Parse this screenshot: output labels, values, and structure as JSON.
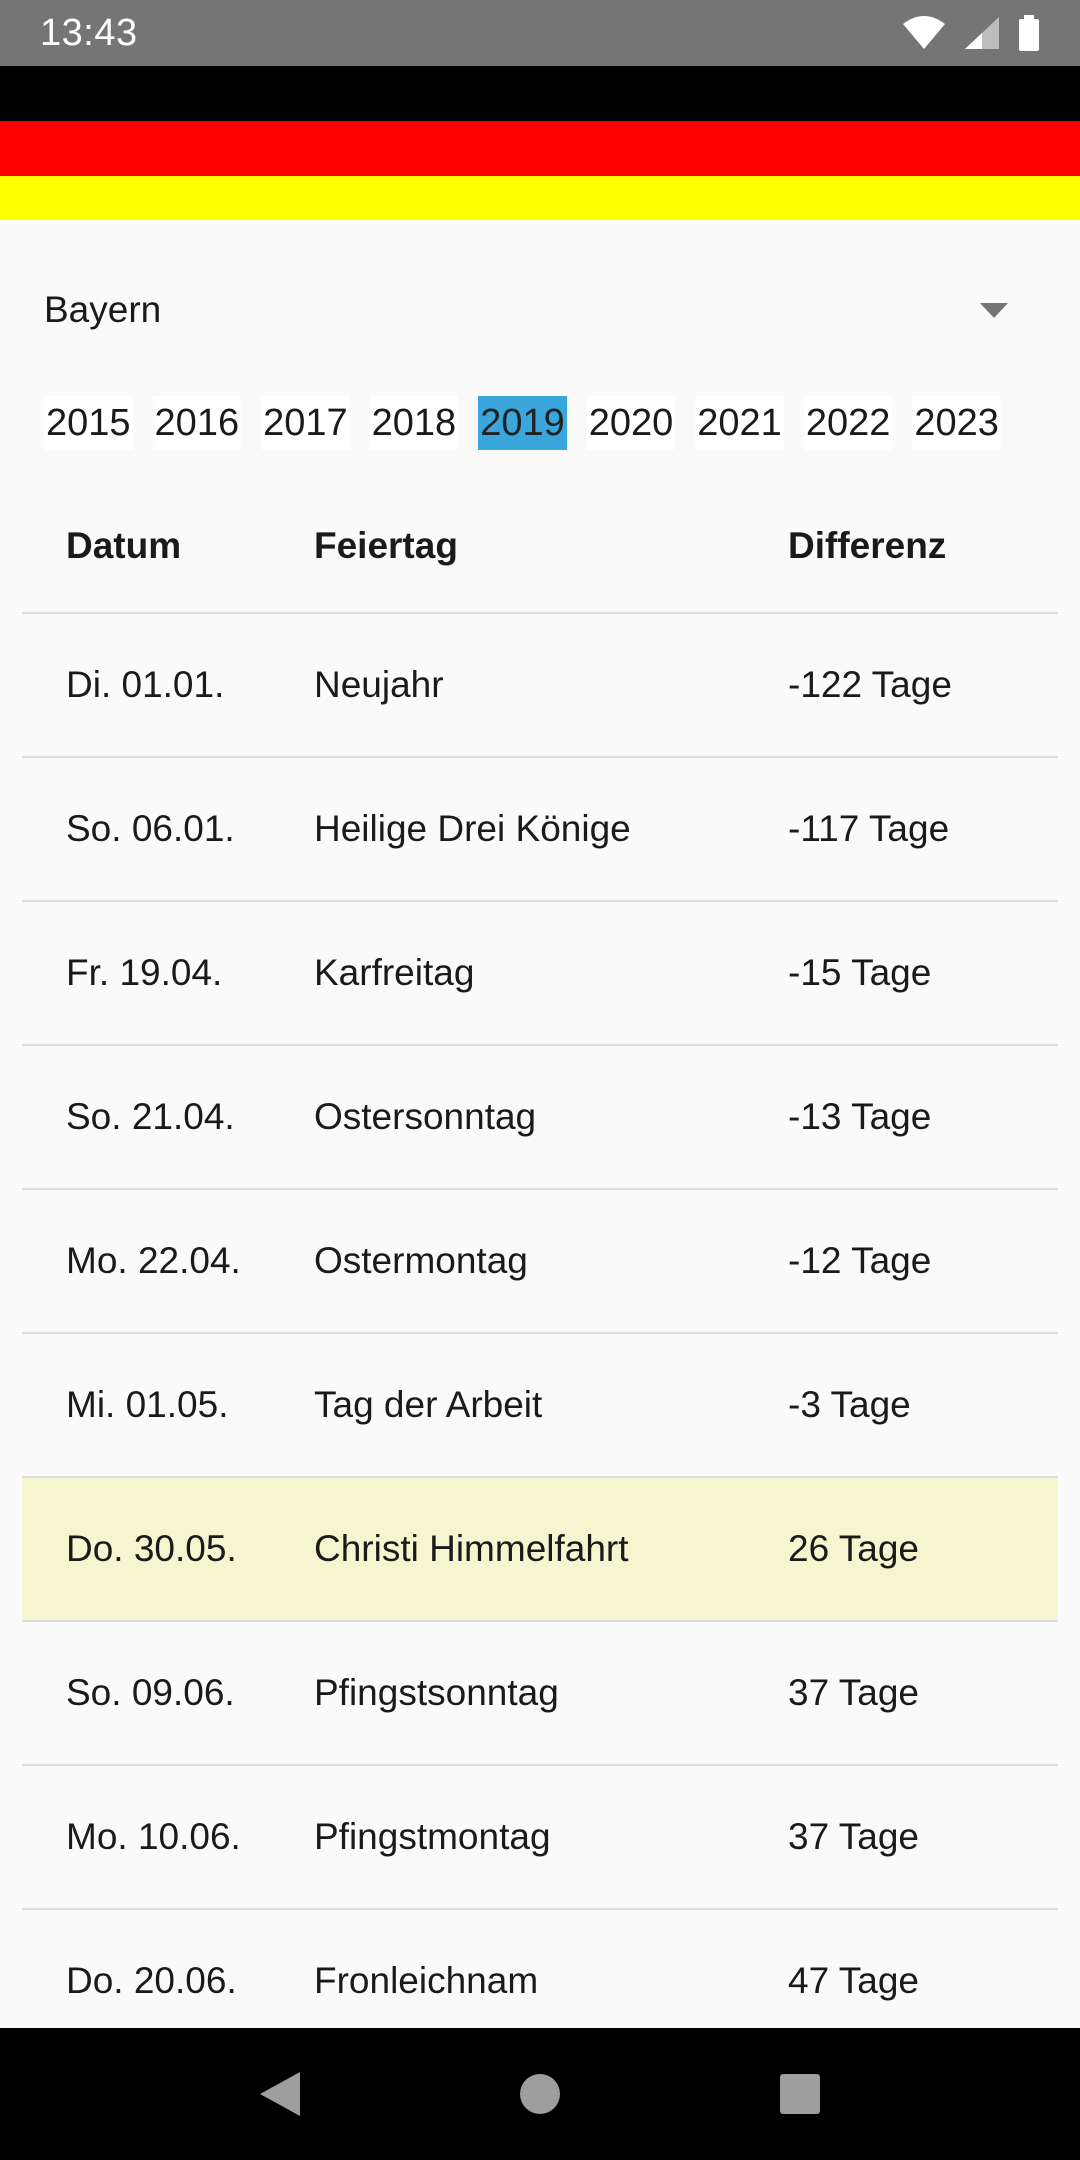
{
  "status_bar": {
    "time": "13:43",
    "icons": [
      "wifi-icon",
      "signal-icon",
      "battery-icon"
    ]
  },
  "flag": {
    "colors": [
      "#000000",
      "#ff0000",
      "#ffff00"
    ]
  },
  "region_select": {
    "selected": "Bayern"
  },
  "years": {
    "items": [
      "2015",
      "2016",
      "2017",
      "2018",
      "2019",
      "2020",
      "2021",
      "2022",
      "2023"
    ],
    "selected": "2019",
    "selected_color": "#3aa6dc"
  },
  "table": {
    "headers": {
      "date": "Datum",
      "holiday": "Feiertag",
      "difference": "Differenz"
    },
    "rows": [
      {
        "date": "Di. 01.01.",
        "holiday": "Neujahr",
        "difference": "-122 Tage"
      },
      {
        "date": "So. 06.01.",
        "holiday": "Heilige Drei Könige",
        "difference": "-117 Tage"
      },
      {
        "date": "Fr. 19.04.",
        "holiday": "Karfreitag",
        "difference": "-15 Tage"
      },
      {
        "date": "So. 21.04.",
        "holiday": "Ostersonntag",
        "difference": "-13 Tage"
      },
      {
        "date": "Mo. 22.04.",
        "holiday": "Ostermontag",
        "difference": "-12 Tage"
      },
      {
        "date": "Mi. 01.05.",
        "holiday": "Tag der Arbeit",
        "difference": "-3 Tage"
      },
      {
        "date": "Do. 30.05.",
        "holiday": "Christi Himmelfahrt",
        "difference": "26 Tage"
      },
      {
        "date": "So. 09.06.",
        "holiday": "Pfingstsonntag",
        "difference": "37 Tage"
      },
      {
        "date": "Mo. 10.06.",
        "holiday": "Pfingstmontag",
        "difference": "37 Tage"
      },
      {
        "date": "Do. 20.06.",
        "holiday": "Fronleichnam",
        "difference": "47 Tage"
      }
    ],
    "highlight_row": 6,
    "highlight_color": "#f5f6cf"
  },
  "nav_bar": {
    "icons": [
      "back-icon",
      "home-icon",
      "recents-icon"
    ]
  }
}
